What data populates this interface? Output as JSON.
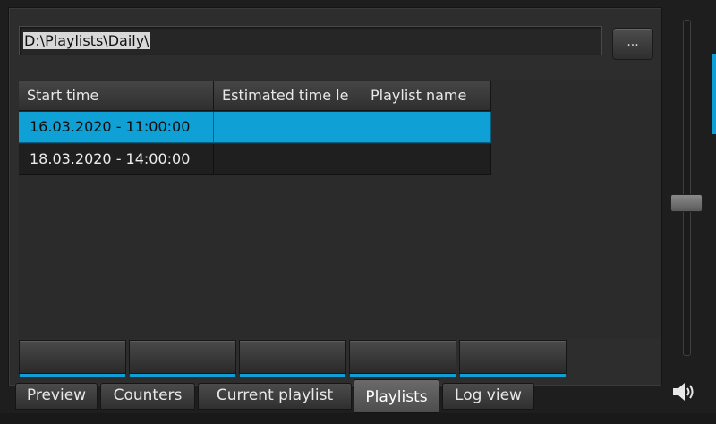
{
  "path": {
    "value": "D:\\Playlists\\Daily\\"
  },
  "browse": {
    "label": "..."
  },
  "table": {
    "columns": [
      "Start time",
      "Estimated time le",
      "Playlist name"
    ],
    "rows": [
      {
        "start": "16.03.2020 - 11:00:00",
        "estimated": "",
        "name": "",
        "selected": true
      },
      {
        "start": "18.03.2020 - 14:00:00",
        "estimated": "",
        "name": "",
        "selected": false
      }
    ]
  },
  "tabs": [
    "Preview",
    "Counters",
    "Current playlist",
    "Playlists",
    "Log view"
  ],
  "active_tab": "Playlists",
  "colors": {
    "accent": "#0fa0d6",
    "background": "#2d2d2d"
  },
  "icons": {
    "speaker": "speaker-icon"
  },
  "volume": {
    "level_fraction": 0.52
  }
}
